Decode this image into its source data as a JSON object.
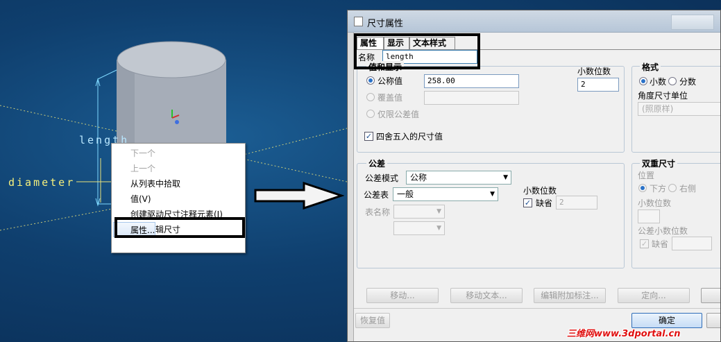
{
  "viewport": {
    "annotations": {
      "length": "length",
      "diameter": "diameter"
    }
  },
  "context_menu": {
    "items": [
      {
        "label": "下一个",
        "enabled": false
      },
      {
        "label": "上一个",
        "enabled": false
      },
      {
        "label": "从列表中拾取",
        "enabled": true
      },
      {
        "label": "值(V)",
        "enabled": true
      },
      {
        "label": "创建驱动尺寸注释元素(I)",
        "enabled": true
      },
      {
        "label": "属性...",
        "enabled": true,
        "selected": true
      },
      {
        "label": "退出编辑尺寸",
        "enabled": true
      }
    ]
  },
  "dialog": {
    "title": "尺寸属性",
    "tabs": [
      "属性",
      "显示",
      "文本样式"
    ],
    "name_label": "名称",
    "name_value": "length",
    "value_group": {
      "title": "值和显示",
      "nominal_label": "公称值",
      "nominal_value": "258.00",
      "override_label": "覆盖值",
      "override_value": "",
      "tol_only_label": "仅限公差值",
      "decimals_label": "小数位数",
      "decimals_value": "2",
      "round_label": "四舍五入的尺寸值",
      "round_checked": true
    },
    "format_group": {
      "title": "格式",
      "decimal_label": "小数",
      "fraction_label": "分数",
      "angle_unit_label": "角度尺寸单位",
      "angle_unit_value": "(照原样)"
    },
    "tolerance_group": {
      "title": "公差",
      "mode_label": "公差模式",
      "mode_value": "公称",
      "table_label": "公差表",
      "table_value": "一般",
      "table_name_label": "表名称",
      "decimals_label": "小数位数",
      "default_label": "缺省",
      "default_checked": true,
      "decimals_value": "2"
    },
    "dual_group": {
      "title": "双重尺寸",
      "position_label": "位置",
      "below_label": "下方",
      "right_label": "右侧",
      "decimals_label": "小数位数",
      "tol_decimals_label": "公差小数位数",
      "default_label": "缺省"
    },
    "buttons": {
      "move": "移动...",
      "move_text": "移动文本...",
      "edit_attached": "编辑附加标注...",
      "orient": "定向...",
      "restore": "恢复值",
      "ok": "确定"
    }
  },
  "watermark": "三维网www.3dportal.cn"
}
